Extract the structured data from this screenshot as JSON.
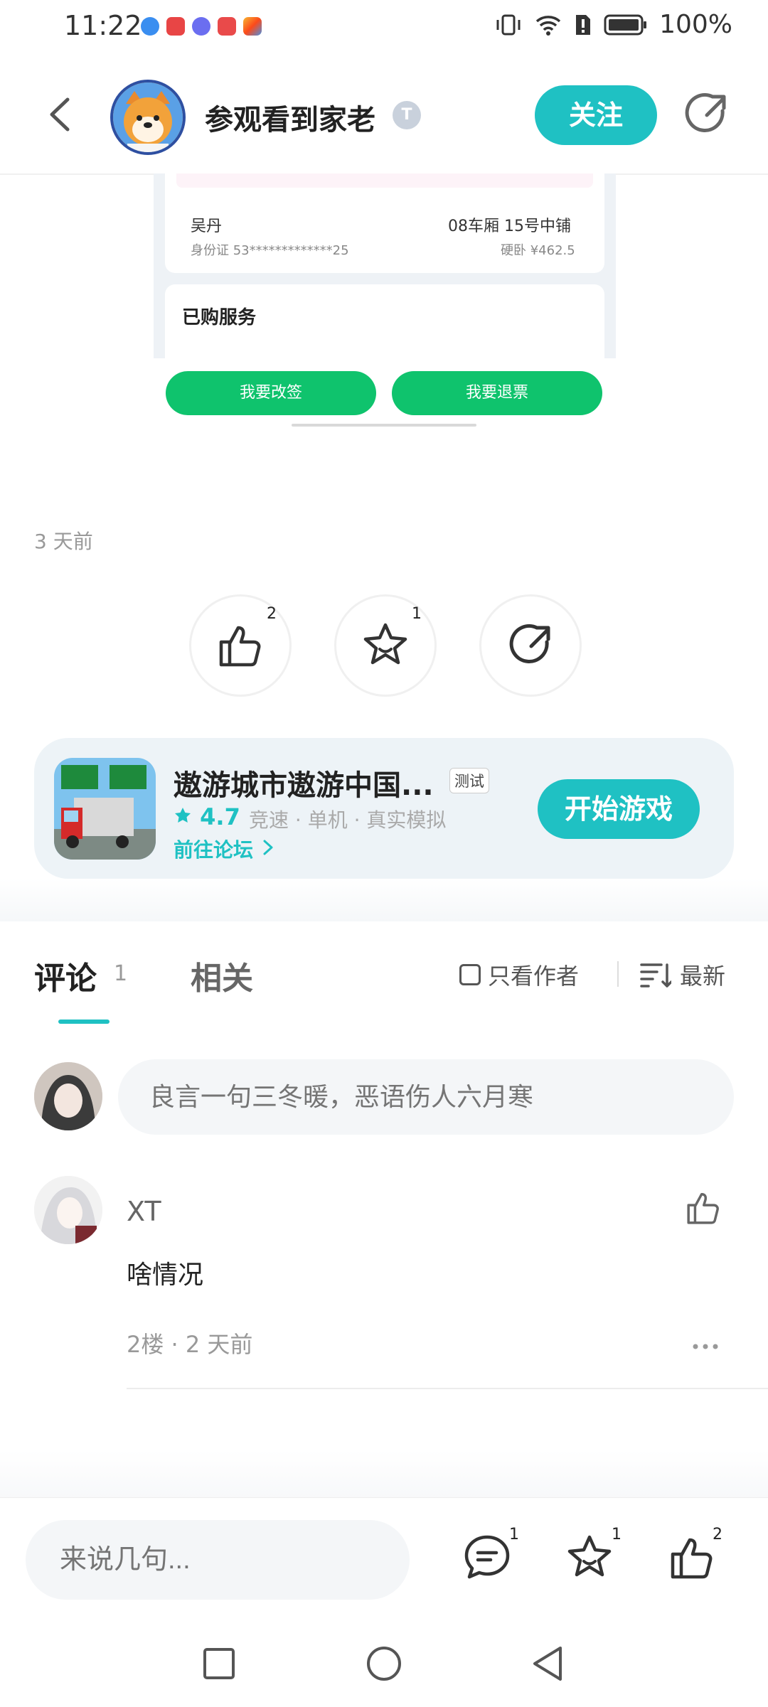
{
  "status_bar": {
    "time": "11:22",
    "battery": "100%"
  },
  "header": {
    "author_name": "参观看到家老",
    "badge": "T",
    "follow_label": "关注"
  },
  "shared_image": {
    "passenger_name": "吴丹",
    "seat": "08车厢 15号中铺",
    "id_number": "身份证 53*************25",
    "price": "硬卧 ¥462.5",
    "services_title": "已购服务",
    "change_button": "我要改签",
    "refund_button": "我要退票"
  },
  "post": {
    "time_ago": "3 天前",
    "like_count": "2",
    "favorite_count": "1"
  },
  "game": {
    "title": "遨游城市遨游中国...",
    "tag": "测试",
    "rating": "4.7",
    "meta": "竞速 · 单机 · 真实模拟",
    "forum_link": "前往论坛",
    "start_label": "开始游戏"
  },
  "tabs": {
    "comments_label": "评论",
    "comments_count": "1",
    "related_label": "相关",
    "only_author": "只看作者",
    "sort": "最新"
  },
  "comment_input": {
    "placeholder": "良言一句三冬暖，恶语伤人六月寒"
  },
  "comments": [
    {
      "name": "XT",
      "text": "啥情况",
      "meta": "2楼 · 2 天前"
    }
  ],
  "bottom_bar": {
    "placeholder": "来说几句...",
    "comment_count": "1",
    "favorite_count": "1",
    "like_count": "2"
  },
  "colors": {
    "accent": "#1fc1c3",
    "green_button": "#0fc36d"
  }
}
